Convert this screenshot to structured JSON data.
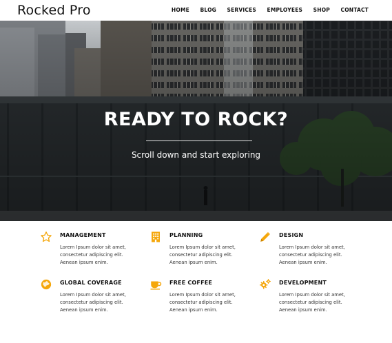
{
  "brand": {
    "logo": "Rocked Pro",
    "accent": "#f5a70b"
  },
  "nav": {
    "items": [
      "HOME",
      "BLOG",
      "SERVICES",
      "EMPLOYEES",
      "SHOP",
      "CONTACT"
    ]
  },
  "hero": {
    "title": "READY TO ROCK?",
    "subtitle": "Scroll down and start exploring"
  },
  "features": [
    {
      "title": "MANAGEMENT",
      "icon": "star-icon",
      "text": "Lorem Ipsum dolor sit amet, consectetur adipiscing elit. Aenean ipsum enim."
    },
    {
      "title": "PLANNING",
      "icon": "building-icon",
      "text": "Lorem Ipsum dolor sit amet, consectetur adipiscing elit. Aenean ipsum enim."
    },
    {
      "title": "DESIGN",
      "icon": "pencil-icon",
      "text": "Lorem Ipsum dolor sit amet, consectetur adipiscing elit. Aenean ipsum enim."
    },
    {
      "title": "GLOBAL COVERAGE",
      "icon": "globe-icon",
      "text": "Lorem Ipsum dolor sit amet, consectetur adipiscing elit. Aenean ipsum enim."
    },
    {
      "title": "FREE COFFEE",
      "icon": "coffee-icon",
      "text": "Lorem Ipsum dolor sit amet, consectetur adipiscing elit. Aenean ipsum enim."
    },
    {
      "title": "DEVELOPMENT",
      "icon": "gears-icon",
      "text": "Lorem Ipsum dolor sit amet, consectetur adipiscing elit. Aenean ipsum enim."
    }
  ]
}
